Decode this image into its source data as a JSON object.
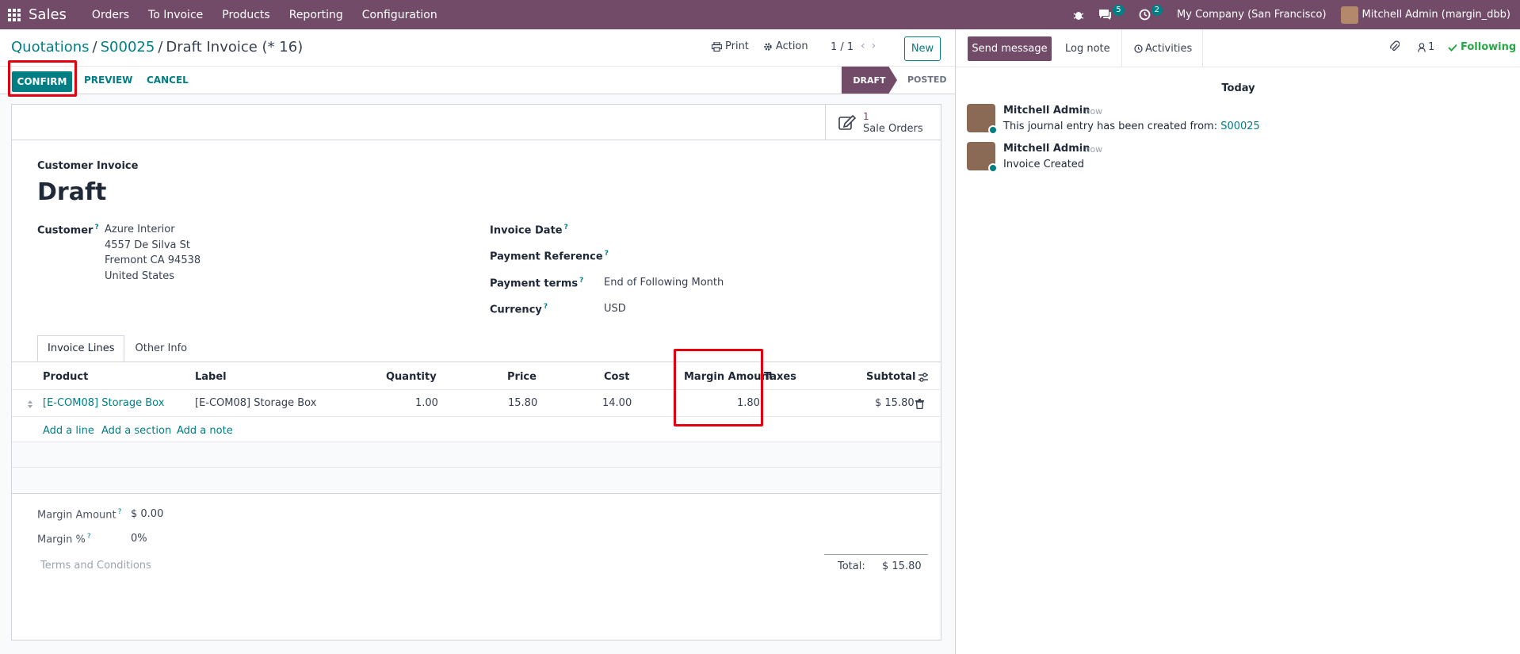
{
  "navbar": {
    "brand": "Sales",
    "menu": [
      "Orders",
      "To Invoice",
      "Products",
      "Reporting",
      "Configuration"
    ],
    "messages_count": "5",
    "activities_count": "2",
    "company": "My Company (San Francisco)",
    "user": "Mitchell Admin (margin_dbb)"
  },
  "breadcrumb": {
    "items": [
      "Quotations",
      "S00025"
    ],
    "current": "Draft Invoice (* 16)"
  },
  "control": {
    "print_label": "Print",
    "action_label": "Action",
    "pager": "1 / 1",
    "new_label": "New"
  },
  "statusbar": {
    "confirm_label": "CONFIRM",
    "preview_label": "PREVIEW",
    "cancel_label": "CANCEL",
    "stages": [
      "DRAFT",
      "POSTED"
    ],
    "active_stage": "DRAFT"
  },
  "smart_button": {
    "count": "1",
    "label": "Sale Orders"
  },
  "form": {
    "doc_type": "Customer Invoice",
    "title": "Draft",
    "customer_label": "Customer",
    "customer_lines": [
      "Azure Interior",
      "4557 De Silva St",
      "Fremont CA 94538",
      "United States"
    ],
    "invoice_date_label": "Invoice Date",
    "payment_reference_label": "Payment Reference",
    "payment_terms_label": "Payment terms",
    "payment_terms_value": "End of Following Month",
    "currency_label": "Currency",
    "currency_value": "USD"
  },
  "tabs": [
    "Invoice Lines",
    "Other Info"
  ],
  "lines": {
    "headers": [
      "Product",
      "Label",
      "Quantity",
      "Price",
      "Cost",
      "Margin Amount",
      "Taxes",
      "Subtotal"
    ],
    "rows": [
      {
        "product": "[E-COM08] Storage Box",
        "label": "[E-COM08] Storage Box",
        "quantity": "1.00",
        "price": "15.80",
        "cost": "14.00",
        "margin_amount": "1.80",
        "taxes": "",
        "subtotal": "$ 15.80"
      }
    ],
    "add_line": "Add a line",
    "add_section": "Add a section",
    "add_note": "Add a note"
  },
  "footer": {
    "margin_amount_label": "Margin Amount",
    "margin_amount_value": "$ 0.00",
    "margin_pct_label": "Margin %",
    "margin_pct_value": "0%",
    "terms_placeholder": "Terms and Conditions",
    "total_label": "Total:",
    "total_value": "$ 15.80"
  },
  "chatter": {
    "send_message": "Send message",
    "log_note": "Log note",
    "activities": "Activities",
    "followers_count": "1",
    "following": "Following",
    "date_separator": "Today",
    "messages": [
      {
        "author": "Mitchell Admin",
        "time": "- now",
        "text": "This journal entry has been created from: ",
        "link": "S00025"
      },
      {
        "author": "Mitchell Admin",
        "time": "- now",
        "text": "Invoice Created",
        "link": ""
      }
    ]
  },
  "colors": {
    "brand": "#714b67",
    "primary": "#017e84",
    "highlight": "#e3000f",
    "following": "#28a745"
  }
}
